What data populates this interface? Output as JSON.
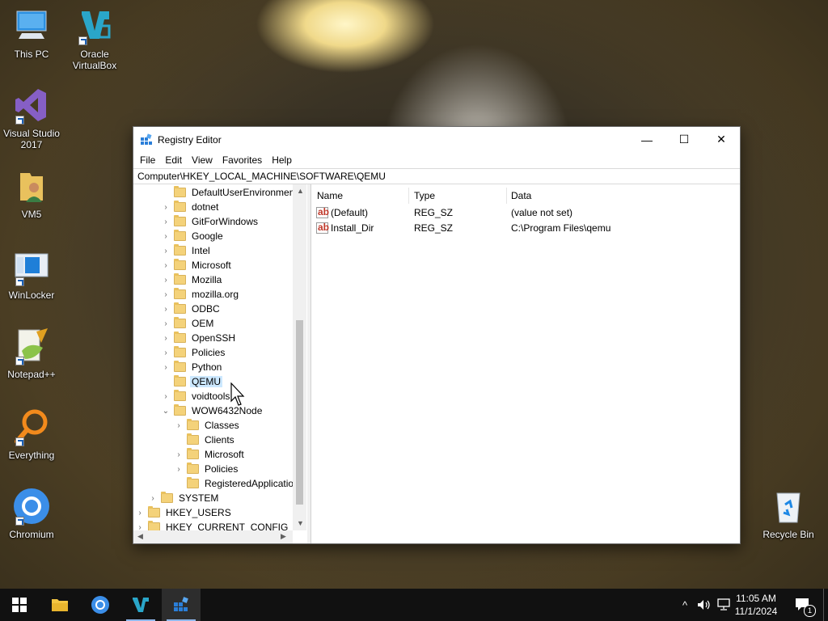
{
  "desktop": {
    "icons": [
      {
        "label": "This PC"
      },
      {
        "label": "Oracle\nVirtualBox"
      },
      {
        "label": "Visual Studio\n2017"
      },
      {
        "label": "VM5"
      },
      {
        "label": "WinLocker"
      },
      {
        "label": "Notepad++"
      },
      {
        "label": "Everything"
      },
      {
        "label": "Chromium"
      },
      {
        "label": "Recycle Bin"
      }
    ]
  },
  "window": {
    "title": "Registry Editor",
    "controls": {
      "minimize": "—",
      "maximize": "☐",
      "close": "✕"
    },
    "menu": [
      "File",
      "Edit",
      "View",
      "Favorites",
      "Help"
    ],
    "address": "Computer\\HKEY_LOCAL_MACHINE\\SOFTWARE\\QEMU",
    "tree": [
      {
        "label": "DefaultUserEnvironment",
        "depth": 2,
        "expander": ""
      },
      {
        "label": "dotnet",
        "depth": 2,
        "expander": "›"
      },
      {
        "label": "GitForWindows",
        "depth": 2,
        "expander": "›"
      },
      {
        "label": "Google",
        "depth": 2,
        "expander": "›"
      },
      {
        "label": "Intel",
        "depth": 2,
        "expander": "›"
      },
      {
        "label": "Microsoft",
        "depth": 2,
        "expander": "›"
      },
      {
        "label": "Mozilla",
        "depth": 2,
        "expander": "›"
      },
      {
        "label": "mozilla.org",
        "depth": 2,
        "expander": "›"
      },
      {
        "label": "ODBC",
        "depth": 2,
        "expander": "›"
      },
      {
        "label": "OEM",
        "depth": 2,
        "expander": "›"
      },
      {
        "label": "OpenSSH",
        "depth": 2,
        "expander": "›"
      },
      {
        "label": "Policies",
        "depth": 2,
        "expander": "›"
      },
      {
        "label": "Python",
        "depth": 2,
        "expander": "›"
      },
      {
        "label": "QEMU",
        "depth": 2,
        "expander": "",
        "selected": true
      },
      {
        "label": "voidtools",
        "depth": 2,
        "expander": "›"
      },
      {
        "label": "WOW6432Node",
        "depth": 2,
        "expander": "⌄"
      },
      {
        "label": "Classes",
        "depth": 3,
        "expander": "›"
      },
      {
        "label": "Clients",
        "depth": 3,
        "expander": ""
      },
      {
        "label": "Microsoft",
        "depth": 3,
        "expander": "›"
      },
      {
        "label": "Policies",
        "depth": 3,
        "expander": "›"
      },
      {
        "label": "RegisteredApplication",
        "depth": 3,
        "expander": ""
      },
      {
        "label": "SYSTEM",
        "depth": 1,
        "expander": "›"
      },
      {
        "label": "HKEY_USERS",
        "depth": 0,
        "expander": "›"
      },
      {
        "label": "HKEY_CURRENT_CONFIG",
        "depth": 0,
        "expander": "›"
      }
    ],
    "columns": {
      "name": "Name",
      "type": "Type",
      "data": "Data"
    },
    "values": [
      {
        "name": "(Default)",
        "type": "REG_SZ",
        "data": "(value not set)"
      },
      {
        "name": "Install_Dir",
        "type": "REG_SZ",
        "data": "C:\\Program Files\\qemu"
      }
    ]
  },
  "taskbar": {
    "clock_time": "11:05 AM",
    "clock_date": "11/1/2024",
    "notification_count": "1"
  }
}
